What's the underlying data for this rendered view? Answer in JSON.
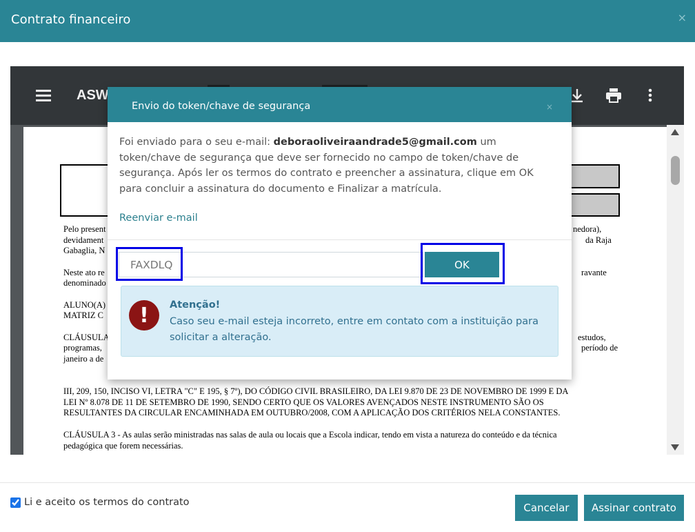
{
  "modal": {
    "title": "Contrato financeiro",
    "close": "×"
  },
  "viewer": {
    "doc_title": "ASW",
    "scroll_position": 0.05,
    "document_lines": [
      {
        "left": "Pelo present",
        "right": "nedora),"
      },
      {
        "left": "devidament",
        "right": "da Raja"
      },
      {
        "left": "Gabaglia, N",
        "right": ""
      },
      {
        "left": "Neste ato re",
        "right": "ravante"
      },
      {
        "left": "denominado",
        "right": ""
      },
      {
        "left": "ALUNO(A)",
        "right": ""
      },
      {
        "left": "MATRIZ C",
        "right": ""
      },
      {
        "left": "CLÁUSULA",
        "right": "estudos,"
      },
      {
        "left": "programas,",
        "right": "período de"
      },
      {
        "left": "janeiro a de",
        "right": ""
      }
    ],
    "clause2_line1": "III, 209, 150, INCISO VI, LETRA \"C\" E 195, § 7º), DO CÓDIGO CIVIL BRASILEIRO, DA LEI 9.870 DE 23 DE NOVEMBRO DE 1999 E DA",
    "clause2_line2": "LEI Nº 8.078 DE 11 DE SETEMBRO DE 1990, SENDO CERTO QUE OS VALORES AVENÇADOS NESTE INSTRUMENTO SÃO OS",
    "clause2_line3": "RESULTANTES DA CIRCULAR ENCAMINHADA EM OUTUBRO/2008, COM A APLICAÇÃO DOS CRITÉRIOS NELA CONSTANTES.",
    "clause3_line1": "CLÁUSULA 3 - As aulas serão ministradas nas salas de aula ou locais que a Escola indicar, tendo em vista a natureza do conteúdo e da técnica",
    "clause3_line2": "pedagógica que forem necessárias."
  },
  "dialog": {
    "title": "Envio do token/chave de segurança",
    "close": "×",
    "message_before": "Foi enviado para o seu e-mail: ",
    "email": "deboraoliveiraandrade5@gmail.com",
    "message_after": " um token/chave de segurança que deve ser fornecido no campo de token/chave de segurança. Após ler os termos do contrato e preencher a assinatura, clique em OK para concluir a assinatura do documento e Finalizar a matrícula.",
    "resend_label": "Reenviar e-mail",
    "token_value": "FAXDLQ",
    "ok_label": "OK",
    "alert": {
      "icon": "!",
      "title": "Atenção!",
      "text": "Caso seu e-mail esteja incorreto, entre em contato com a instituição para solicitar a alteração."
    }
  },
  "footer": {
    "accept_terms_label": "Li e aceito os termos do contrato",
    "accept_terms_checked": true,
    "cancel_label": "Cancelar",
    "sign_label": "Assinar contrato"
  },
  "colors": {
    "brand": "#2a8595",
    "highlight": "#0000e6",
    "alert_bg": "#d9edf7",
    "alert_icon": "#8b1414"
  }
}
